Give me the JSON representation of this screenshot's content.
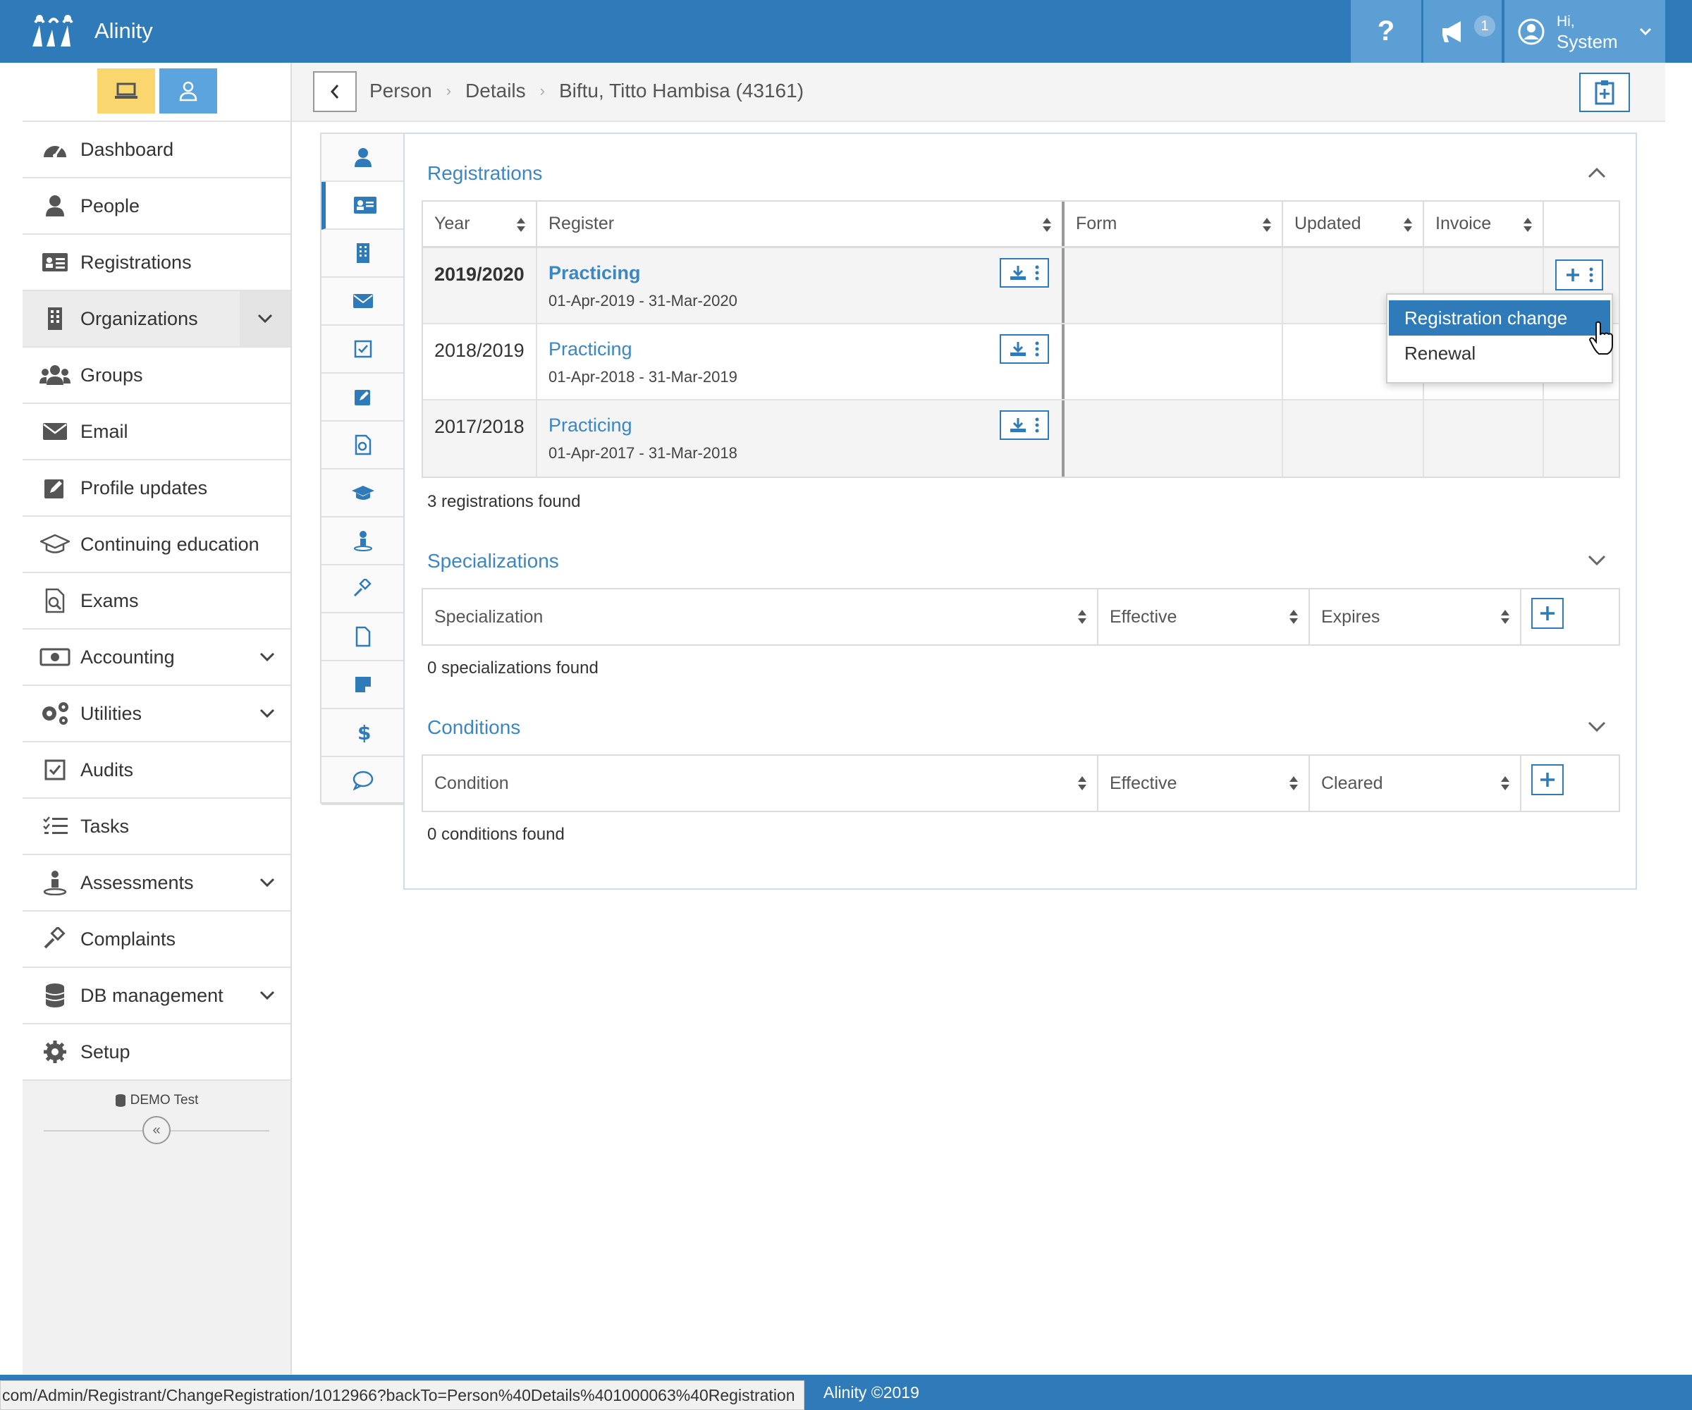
{
  "app": {
    "name": "Alinity"
  },
  "header": {
    "help_label": "?",
    "notification_count": "1",
    "user_greeting": "Hi,",
    "user_name": "System"
  },
  "sidebar": {
    "items": [
      {
        "label": "Dashboard",
        "icon": "dashboard-icon"
      },
      {
        "label": "People",
        "icon": "person-icon"
      },
      {
        "label": "Registrations",
        "icon": "id-card-icon"
      },
      {
        "label": "Organizations",
        "icon": "building-icon",
        "expandable": true
      },
      {
        "label": "Groups",
        "icon": "users-icon"
      },
      {
        "label": "Email",
        "icon": "envelope-icon"
      },
      {
        "label": "Profile updates",
        "icon": "edit-icon"
      },
      {
        "label": "Continuing education",
        "icon": "graduation-cap-icon"
      },
      {
        "label": "Exams",
        "icon": "exam-icon"
      },
      {
        "label": "Accounting",
        "icon": "money-icon",
        "expandable": true
      },
      {
        "label": "Utilities",
        "icon": "gears-icon",
        "expandable": true
      },
      {
        "label": "Audits",
        "icon": "check-square-icon"
      },
      {
        "label": "Tasks",
        "icon": "tasks-icon"
      },
      {
        "label": "Assessments",
        "icon": "assessment-icon",
        "expandable": true
      },
      {
        "label": "Complaints",
        "icon": "gavel-icon"
      },
      {
        "label": "DB management",
        "icon": "database-icon",
        "expandable": true
      },
      {
        "label": "Setup",
        "icon": "gear-icon"
      }
    ],
    "db_label": "DEMO Test",
    "collapse_label": "«"
  },
  "breadcrumb": {
    "items": [
      "Person",
      "Details"
    ],
    "current": "Biftu, Titto Hambisa (43161)"
  },
  "registrations": {
    "title": "Registrations",
    "columns": [
      "Year",
      "Register",
      "Form",
      "Updated",
      "Invoice"
    ],
    "rows": [
      {
        "year": "2019/2020",
        "register": "Practicing",
        "dates": "01-Apr-2019 - 31-Mar-2020"
      },
      {
        "year": "2018/2019",
        "register": "Practicing",
        "dates": "01-Apr-2018 - 31-Mar-2019"
      },
      {
        "year": "2017/2018",
        "register": "Practicing",
        "dates": "01-Apr-2017 - 31-Mar-2018"
      }
    ],
    "found_text": "3 registrations found",
    "menu": [
      "Registration change",
      "Renewal"
    ]
  },
  "specializations": {
    "title": "Specializations",
    "columns": [
      "Specialization",
      "Effective",
      "Expires"
    ],
    "found_text": "0 specializations found"
  },
  "conditions": {
    "title": "Conditions",
    "columns": [
      "Condition",
      "Effective",
      "Cleared"
    ],
    "found_text": "0 conditions found"
  },
  "footer": {
    "copyright": "Alinity ©2019",
    "status_url": "com/Admin/Registrant/ChangeRegistration/1012966?backTo=Person%40Details%401000063%40Registration"
  },
  "colors": {
    "brand": "#2f7ab8",
    "link": "#3b87c4",
    "admin_mode": "#f9d66e",
    "person_mode": "#5ba4de"
  }
}
